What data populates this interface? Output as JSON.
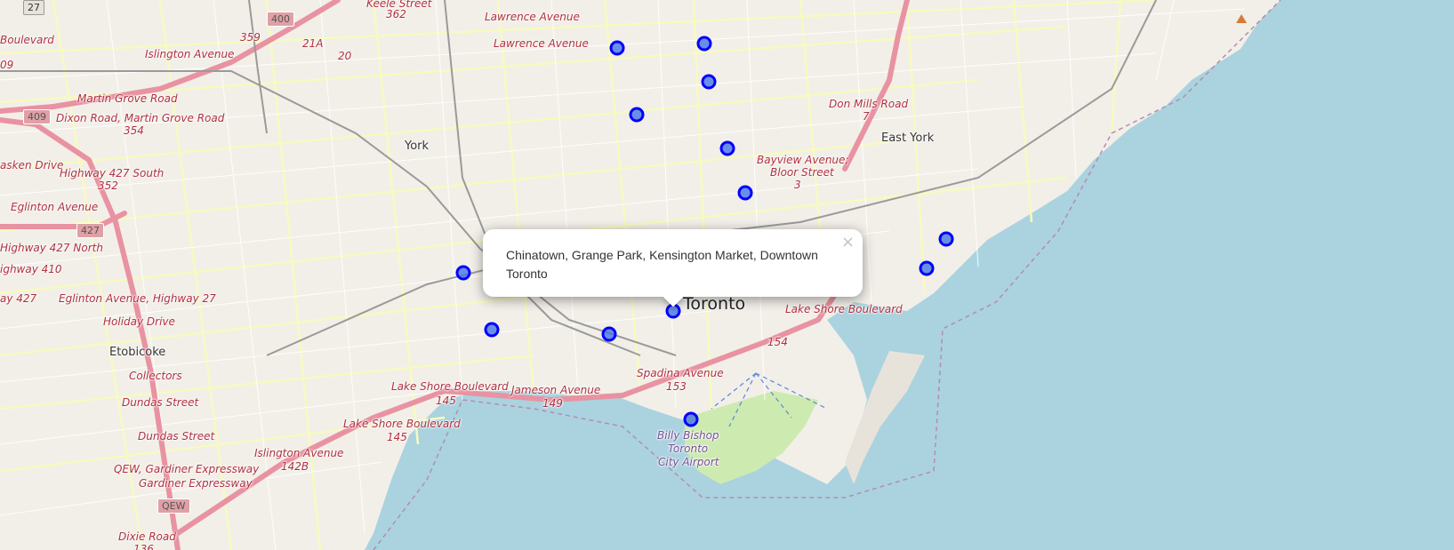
{
  "map": {
    "colors": {
      "water": "#aad3df",
      "land": "#f2efe9",
      "park": "#cdebb0",
      "road_major": "#e892a2",
      "road_secondary": "#f7fabf",
      "grid": "#ffffff"
    },
    "place_labels": {
      "toronto": "Toronto",
      "york": "York",
      "east_york": "East York",
      "etobicoke": "Etobicoke",
      "airport": [
        "Billy Bishop",
        "Toronto",
        "City Airport"
      ]
    },
    "road_labels": {
      "keele": "Keele Street",
      "keele_num": "362",
      "lawrence1": "Lawrence Avenue",
      "lawrence2": "Lawrence Avenue",
      "boulevard": "Boulevard",
      "islington": "Islington Avenue",
      "r359": "359",
      "r21a": "21A",
      "r20": "20",
      "r09": "09",
      "martin_grove": "Martin Grove Road",
      "dixon": "Dixon Road, Martin Grove Road",
      "dixon_num": "354",
      "kasken": "asken Drive",
      "hwy427s": "Highway 427 South",
      "hwy427s_num": "352",
      "eglinton1": "Eglinton Avenue",
      "hwy427n": "Highway 427 North",
      "hwy410": "ighway 410",
      "ay427": "ay 427",
      "eglinton2": "Eglinton Avenue, Highway 27",
      "holiday": "Holiday Drive",
      "collectors": "Collectors",
      "dundas1": "Dundas Street",
      "dundas2": "Dundas Street",
      "qew": "QEW, Gardiner Expressway",
      "gardiner": "Gardiner Expressway",
      "dixie": "Dixie Road",
      "dixie_num": "136",
      "lakeshore1": "Lake Shore Boulevard",
      "lakeshore1_num": "145",
      "lakeshore2": "Lake Shore Boulevard",
      "lakeshore2_num": "145",
      "islington2": "Islington Avenue",
      "islington2_num": "142B",
      "jameson": "Jameson Avenue",
      "jameson_num": "149",
      "spadina": "Spadina Avenue",
      "spadina_num": "153",
      "r154": "154",
      "lakeshore3": "Lake Shore Boulevard",
      "don_mills": "Don Mills Road",
      "don_mills_num": "7",
      "bayview": "Bayview Avenue;",
      "bloor": "Bloor Street",
      "bloor_num": "3"
    },
    "shields": {
      "s27": "27",
      "s400": "400",
      "s409": "409",
      "s427": "427",
      "sqew": "QEW"
    },
    "markers": [
      {
        "name": "marker-1"
      },
      {
        "name": "marker-2"
      },
      {
        "name": "marker-3"
      },
      {
        "name": "marker-4"
      },
      {
        "name": "marker-5"
      },
      {
        "name": "marker-6"
      },
      {
        "name": "marker-7"
      },
      {
        "name": "marker-8"
      },
      {
        "name": "marker-9"
      },
      {
        "name": "marker-10"
      },
      {
        "name": "marker-11"
      },
      {
        "name": "marker-12"
      },
      {
        "name": "marker-13"
      },
      {
        "name": "marker-14"
      }
    ],
    "popup": {
      "text": "Chinatown, Grange Park, Kensington Market, Downtown Toronto",
      "close_glyph": "×"
    }
  }
}
